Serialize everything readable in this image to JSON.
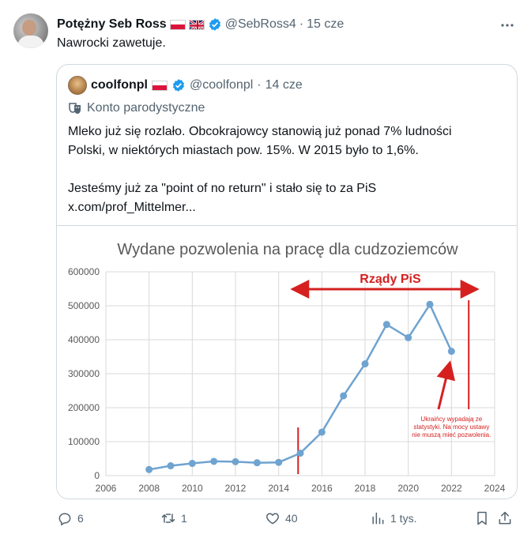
{
  "tweet": {
    "author_name": "Potężny Seb Ross",
    "handle": "@SebRoss4",
    "separator": "·",
    "time": "15 cze",
    "text": "Nawrocki zawetuje."
  },
  "quote": {
    "author_name": "coolfonpl",
    "handle": "@coolfonpl",
    "separator": "·",
    "time": "14 cze",
    "parody_label": "Konto parodystyczne",
    "lines": [
      "Mleko już się rozlało. Obcokrajowcy stanowią już ponad 7% ludności",
      "Polski, w niektórych miastach pow. 15%. W 2015 było to 1,6%.",
      "Jesteśmy już za \"point of no return\" i stało się to za PiS",
      "x.com/prof_Mittelmer..."
    ]
  },
  "chart_data": {
    "type": "line",
    "title": "Wydane pozwolenia na pracę dla cudzoziemców",
    "x": [
      2008,
      2009,
      2010,
      2011,
      2012,
      2013,
      2014,
      2015,
      2016,
      2017,
      2018,
      2019,
      2020,
      2021,
      2022
    ],
    "values": [
      18000,
      29000,
      36000,
      42000,
      41000,
      38000,
      39000,
      66000,
      128000,
      235000,
      329000,
      445000,
      406000,
      504000,
      366000
    ],
    "xlim": [
      2006,
      2024
    ],
    "ylim": [
      0,
      600000
    ],
    "x_ticks": [
      "2006",
      "2008",
      "2010",
      "2012",
      "2014",
      "2016",
      "2018",
      "2020",
      "2022",
      "2024"
    ],
    "y_ticks": [
      "0",
      "100000",
      "200000",
      "300000",
      "400000",
      "500000",
      "600000"
    ],
    "annotation_rule": "Rządy PiS",
    "annotation_note": [
      "Ukraińcy wypadają ze",
      "statystyki. Na mocy ustawy",
      "nie muszą mieć pozwolenia."
    ],
    "line_color": "#6fa3d0",
    "annotation_color": "#d62020"
  },
  "actions": {
    "replies": "6",
    "reposts": "1",
    "likes": "40",
    "views": "1 tys."
  },
  "colors": {
    "accent": "#1d9bf0",
    "muted": "#536471"
  }
}
